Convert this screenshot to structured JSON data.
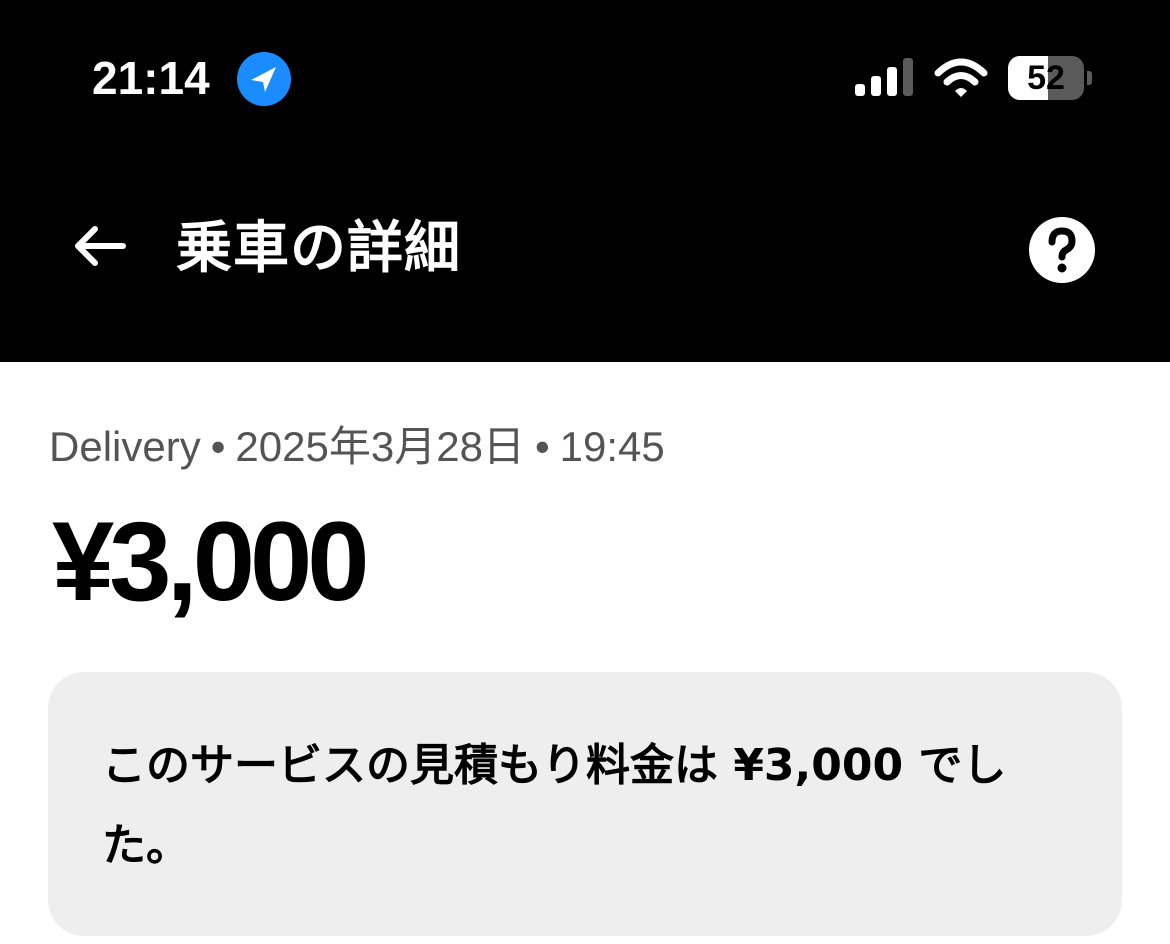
{
  "status_bar": {
    "time": "21:14",
    "battery_percent": "52",
    "battery_level": 0.52,
    "icons": [
      "location-arrow-icon",
      "cellular-signal-icon",
      "wifi-icon",
      "battery-icon"
    ]
  },
  "nav": {
    "back_icon": "arrow-left-icon",
    "title": "乗車の詳細",
    "help_icon": "question-circle-icon"
  },
  "trip": {
    "type": "Delivery",
    "separator": "•",
    "date": "2025年3月28日",
    "time": "19:45",
    "price": "¥3,000"
  },
  "notice": {
    "text": "このサービスの見積もり料金は ¥3,000 でした。"
  },
  "colors": {
    "header_bg": "#000000",
    "location_blue": "#1a8cff",
    "meta_text": "#545454",
    "card_bg": "#eeeeee"
  }
}
